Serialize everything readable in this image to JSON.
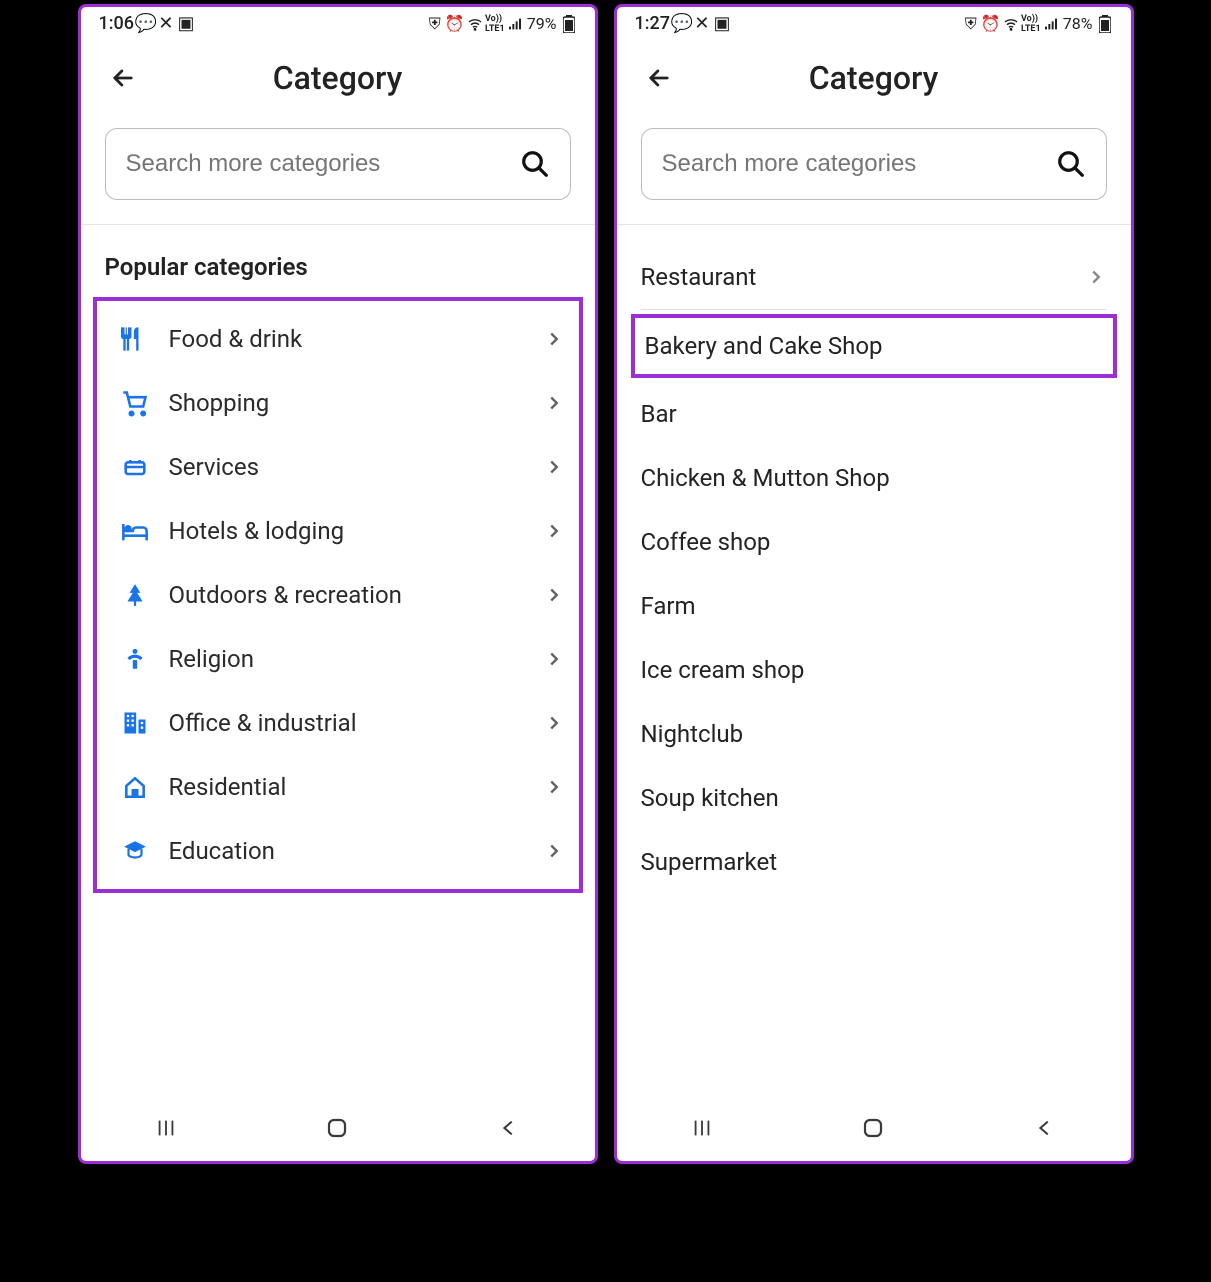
{
  "left": {
    "status": {
      "time": "1:06",
      "battery": "79%"
    },
    "header": {
      "title": "Category"
    },
    "search": {
      "placeholder": "Search more categories"
    },
    "section_title": "Popular categories",
    "categories": [
      {
        "icon": "food",
        "label": "Food & drink"
      },
      {
        "icon": "shopping",
        "label": "Shopping"
      },
      {
        "icon": "services",
        "label": "Services"
      },
      {
        "icon": "hotels",
        "label": "Hotels & lodging"
      },
      {
        "icon": "outdoors",
        "label": "Outdoors & recreation"
      },
      {
        "icon": "religion",
        "label": "Religion"
      },
      {
        "icon": "office",
        "label": "Office & industrial"
      },
      {
        "icon": "residential",
        "label": "Residential"
      },
      {
        "icon": "education",
        "label": "Education"
      }
    ]
  },
  "right": {
    "status": {
      "time": "1:27",
      "battery": "78%"
    },
    "header": {
      "title": "Category"
    },
    "search": {
      "placeholder": "Search more categories"
    },
    "top_item": "Restaurant",
    "highlighted": "Bakery and Cake Shop",
    "subcategories": [
      "Bar",
      "Chicken & Mutton Shop",
      "Coffee shop",
      "Farm",
      "Ice cream shop",
      "Nightclub",
      "Soup kitchen",
      "Supermarket"
    ]
  }
}
